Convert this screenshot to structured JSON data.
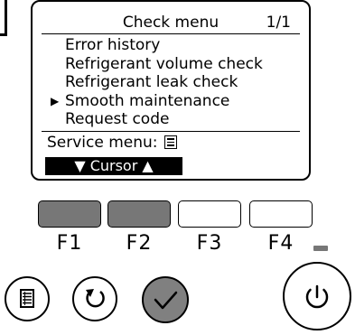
{
  "screen": {
    "title": "Check menu",
    "page": "1/1",
    "menu_items": [
      {
        "label": "Error history",
        "selected": false
      },
      {
        "label": "Refrigerant volume check",
        "selected": false
      },
      {
        "label": "Refrigerant leak check",
        "selected": false
      },
      {
        "label": "Smooth maintenance",
        "selected": true
      },
      {
        "label": "Request code",
        "selected": false
      }
    ],
    "selection_marker": "▶",
    "service_menu_label": "Service menu:",
    "cursor_bar_label": "▼ Cursor ▲"
  },
  "function_keys": [
    {
      "label": "F1",
      "state": "highlighted"
    },
    {
      "label": "F2",
      "state": "highlighted"
    },
    {
      "label": "F3",
      "state": "normal"
    },
    {
      "label": "F4",
      "state": "normal"
    }
  ],
  "buttons": {
    "menu": "menu-icon",
    "back": "back-arrow-icon",
    "confirm": "checkmark-icon",
    "power": "power-icon"
  },
  "colors": {
    "highlight_gray": "#777777",
    "confirm_fill": "#808080",
    "cursor_bar": "#000000"
  }
}
